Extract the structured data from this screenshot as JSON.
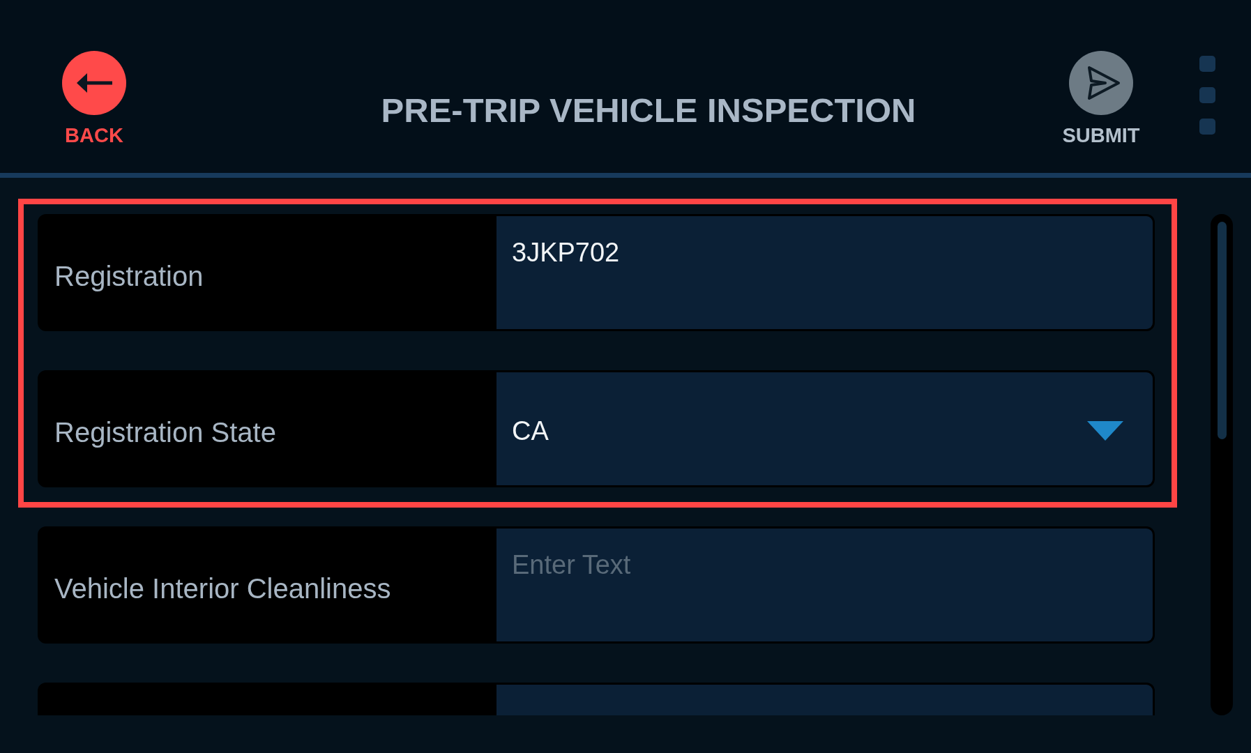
{
  "header": {
    "back_label": "BACK",
    "title": "PRE-TRIP VEHICLE INSPECTION",
    "submit_label": "SUBMIT"
  },
  "groups": [
    {
      "highlighted": true,
      "fields": [
        {
          "kind": "text",
          "label": "Registration",
          "value": "3JKP702"
        },
        {
          "kind": "select",
          "label": "Registration State",
          "value": "CA"
        }
      ]
    },
    {
      "highlighted": false,
      "fields": [
        {
          "kind": "text",
          "label": "Vehicle Interior Cleanliness",
          "placeholder": "Enter Text"
        },
        {
          "kind": "text"
        }
      ]
    }
  ]
}
